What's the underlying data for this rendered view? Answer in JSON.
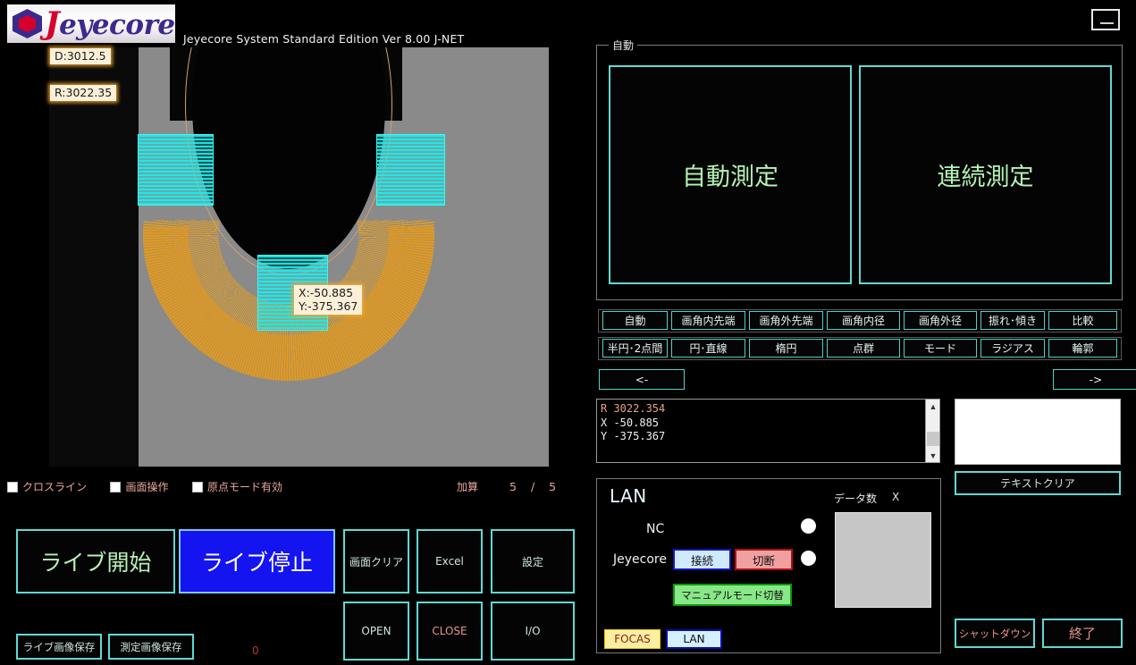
{
  "app": {
    "logo_text": "eyecore",
    "logo_initial": "J",
    "title": "Jeyecore System Standard Edition Ver 8.00 J-NET",
    "minimize_icon": "minimize-icon"
  },
  "viewport": {
    "label_diameter": "D:3012.5",
    "label_radius": "R:3022.35",
    "label_xy": "X:-50.885\nY:-375.367"
  },
  "options": {
    "crossline": "クロスライン",
    "screen_op": "画面操作",
    "origin_mode": "原点モード有効",
    "accumulate": "加算",
    "count_current": "5",
    "count_separator": "/",
    "count_total": "5"
  },
  "left_buttons": {
    "live_start": "ライブ開始",
    "live_stop": "ライブ停止",
    "screen_clear": "画面クリア",
    "excel": "Excel",
    "settings": "設定",
    "open": "OPEN",
    "close": "CLOSE",
    "io": "I/O",
    "save_live_image": "ライブ画像保存",
    "save_measure_image": "測定画像保存",
    "zero_indicator": "0"
  },
  "auto_group": {
    "title": "自動",
    "auto_measure": "自動測定",
    "continuous_measure": "連続測定"
  },
  "mode_row1": [
    "自動",
    "画角内先端",
    "画角外先端",
    "画角内径",
    "画角外径",
    "振れ･傾き",
    "比較"
  ],
  "mode_row2": [
    "半円･2点間",
    "円･直線",
    "楕円",
    "点群",
    "モード",
    "ラジアス",
    "輪郭"
  ],
  "nav": {
    "prev": "<-",
    "next": "->"
  },
  "result": {
    "line_r": "R  3022.354",
    "line_x": "X  -50.885",
    "line_y": "Y  -375.367",
    "scroll_up_icon": "chevron-up-icon",
    "scroll_down_icon": "chevron-down-icon"
  },
  "text_panel": {
    "value": "",
    "clear_button": "テキストクリア"
  },
  "lan": {
    "title": "LAN",
    "nc_label": "NC",
    "jeyecore_label": "Jeyecore",
    "connect": "接続",
    "disconnect": "切断",
    "manual_mode": "マニュアルモード切替",
    "data_count_label": "データ数",
    "data_count_value": "X",
    "tabs": [
      "FOCAS",
      "LAN"
    ]
  },
  "system": {
    "shutdown": "シャットダウン",
    "exit": "終了"
  },
  "colors": {
    "accent_cyan": "#54cfc8",
    "accent_green": "#b3f3b3",
    "accent_salmon": "#e8a79b",
    "active_blue": "#1414f0",
    "image_bg": "#8a8a8a",
    "annulus_orange": "#e89916",
    "roi_cyan": "#3df7f7"
  }
}
